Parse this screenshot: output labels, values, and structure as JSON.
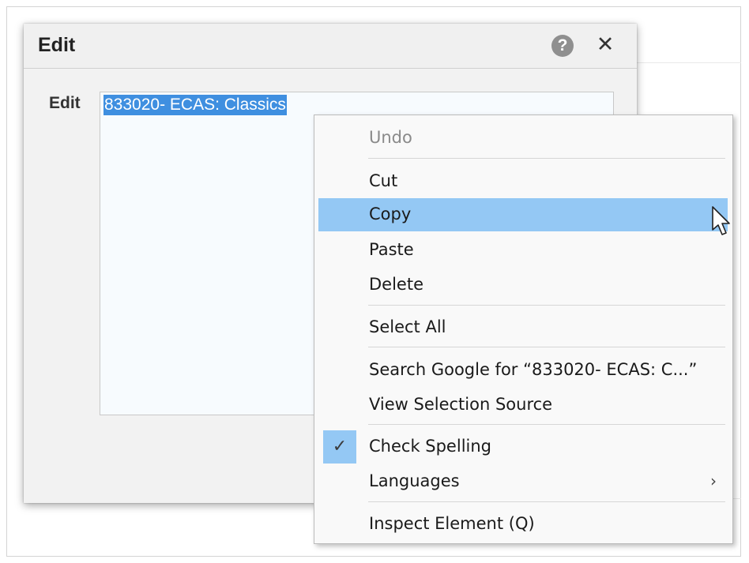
{
  "dialog": {
    "title": "Edit",
    "help_icon": "question-circle-icon",
    "close_icon": "close-x-icon",
    "help_glyph": "?",
    "close_glyph": "✕",
    "field_label": "Edit",
    "field_value": "833020- ECAS: Classics"
  },
  "context_menu": {
    "undo": "Undo",
    "cut": "Cut",
    "copy": "Copy",
    "paste": "Paste",
    "delete": "Delete",
    "select_all": "Select All",
    "search_google": "Search Google for “833020- ECAS: C...”",
    "view_selection_source": "View Selection Source",
    "check_spelling": "Check Spelling",
    "check_spelling_checked": true,
    "check_glyph": "✓",
    "languages": "Languages",
    "languages_arrow": "›",
    "inspect_element": "Inspect Element (Q)",
    "hovered_item": "Copy"
  },
  "colors": {
    "selection": "#3f8fe0",
    "menu_hover": "#94c8f4",
    "dialog_bg": "#f2f2f2"
  }
}
